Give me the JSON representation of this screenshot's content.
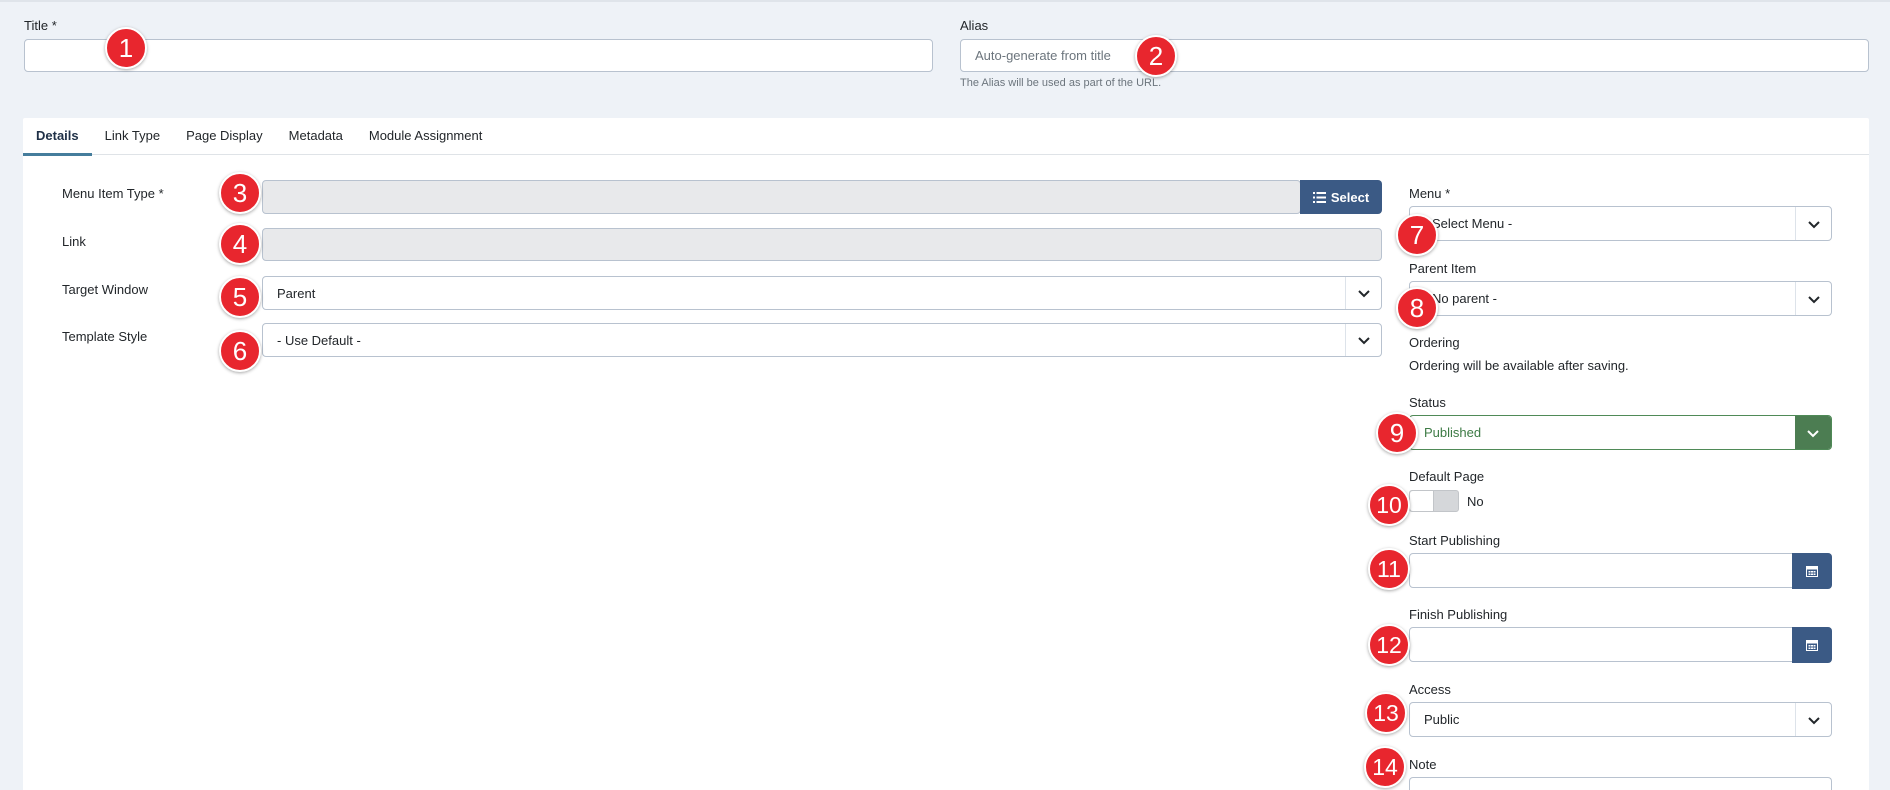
{
  "fields": {
    "title_label": "Title *",
    "title_value": "",
    "alias_label": "Alias",
    "alias_placeholder": "Auto-generate from title",
    "alias_help": "The Alias will be used as part of the URL."
  },
  "tabs": [
    {
      "label": "Details",
      "active": true
    },
    {
      "label": "Link Type",
      "active": false
    },
    {
      "label": "Page Display",
      "active": false
    },
    {
      "label": "Metadata",
      "active": false
    },
    {
      "label": "Module Assignment",
      "active": false
    }
  ],
  "details": {
    "menu_item_type_label": "Menu Item Type *",
    "select_button_label": "Select",
    "link_label": "Link",
    "target_window_label": "Target Window",
    "target_window_value": "Parent",
    "template_style_label": "Template Style",
    "template_style_value": "- Use Default -"
  },
  "sidebar": {
    "menu_label": "Menu *",
    "menu_value": "- Select Menu -",
    "parent_label": "Parent Item",
    "parent_value": "- No parent -",
    "ordering_label": "Ordering",
    "ordering_help": "Ordering will be available after saving.",
    "status_label": "Status",
    "status_value": "Published",
    "default_page_label": "Default Page",
    "default_page_value": "No",
    "start_publishing_label": "Start Publishing",
    "finish_publishing_label": "Finish Publishing",
    "access_label": "Access",
    "access_value": "Public",
    "note_label": "Note"
  },
  "badges": [
    "1",
    "2",
    "3",
    "4",
    "5",
    "6",
    "7",
    "8",
    "9",
    "10",
    "11",
    "12",
    "13",
    "14"
  ],
  "colors": {
    "primary": "#3b5a85",
    "success": "#4c7d52",
    "badge": "#e8262e",
    "background": "#eef2f7"
  }
}
